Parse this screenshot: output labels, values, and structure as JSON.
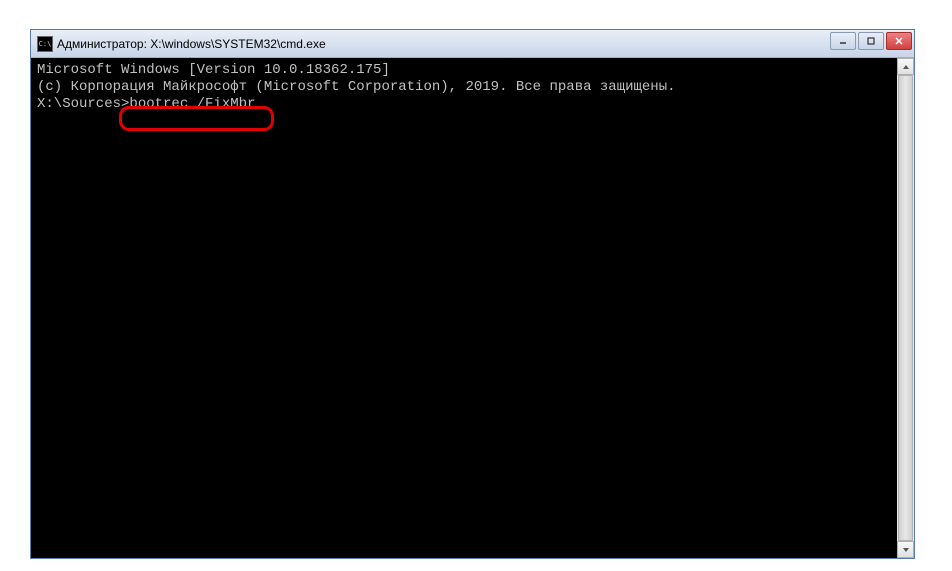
{
  "window": {
    "title": "Администратор: X:\\windows\\SYSTEM32\\cmd.exe",
    "icon_label": "C:\\"
  },
  "terminal": {
    "line1": "Microsoft Windows [Version 10.0.18362.175]",
    "line2": "(c) Корпорация Майкрософт (Microsoft Corporation), 2019. Все права защищены.",
    "blank": "",
    "prompt": "X:\\Sources>",
    "command": "bootrec /FixMbr"
  }
}
